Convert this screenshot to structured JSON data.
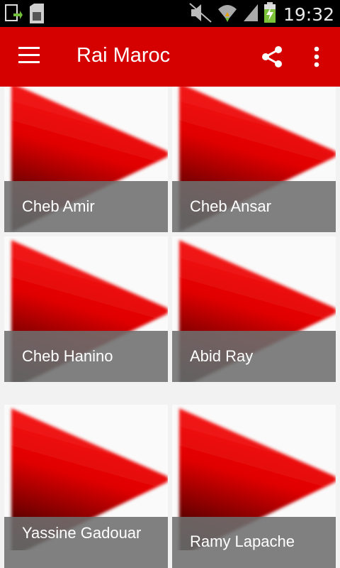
{
  "status_bar": {
    "time": "19:32",
    "icons": [
      "download-notification-icon",
      "sd-card-icon",
      "mute-icon",
      "wifi-icon",
      "signal-icon",
      "battery-charging-icon"
    ]
  },
  "app_bar": {
    "title": "Rai Maroc",
    "background": "#d50000",
    "icons": [
      "menu-icon",
      "share-icon",
      "more-vert-icon"
    ]
  },
  "grid": {
    "items": [
      {
        "label": "Cheb Amir"
      },
      {
        "label": "Cheb Ansar"
      },
      {
        "label": "Cheb Hanino"
      },
      {
        "label": "Abid Ray"
      },
      {
        "label": "Yassine Gadouar"
      },
      {
        "label": "Ramy Lapache"
      }
    ]
  }
}
